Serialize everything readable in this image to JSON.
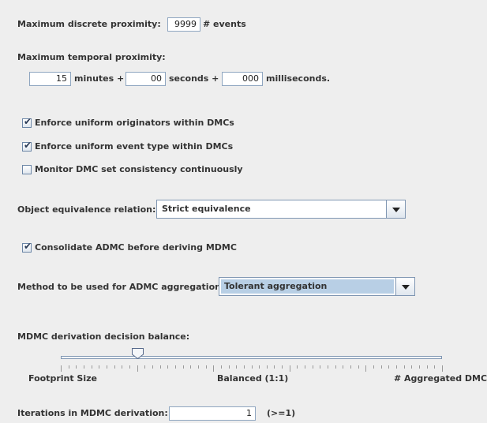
{
  "discrete": {
    "label": "Maximum discrete proximity:",
    "value": "9999",
    "unit": "# events"
  },
  "temporal": {
    "label": "Maximum temporal proximity:",
    "minutes": "15",
    "minutes_label": "minutes +",
    "seconds": "00",
    "seconds_label": "seconds +",
    "milliseconds": "000",
    "milliseconds_label": "milliseconds."
  },
  "checkboxes": [
    {
      "label": "Enforce uniform originators within DMCs",
      "checked": true
    },
    {
      "label": "Enforce uniform event type within DMCs",
      "checked": true
    },
    {
      "label": "Monitor DMC set consistency continuously",
      "checked": false
    }
  ],
  "equivalence": {
    "label": "Object equivalence relation:",
    "value": "Strict equivalence"
  },
  "consolidate": {
    "label": "Consolidate ADMC before deriving MDMC",
    "checked": true
  },
  "aggregation": {
    "label": "Method to be used for ADMC aggregation:",
    "value": "Tolerant aggregation"
  },
  "balance": {
    "label": "MDMC derivation decision balance:",
    "left": "Footprint Size",
    "center": "Balanced (1:1)",
    "right": "# Aggregated DMCs",
    "position": 0.2
  },
  "iterations": {
    "label": "Iterations in MDMC derivation:",
    "value": "1",
    "hint": "(>=1)"
  },
  "check_mark": "✔"
}
